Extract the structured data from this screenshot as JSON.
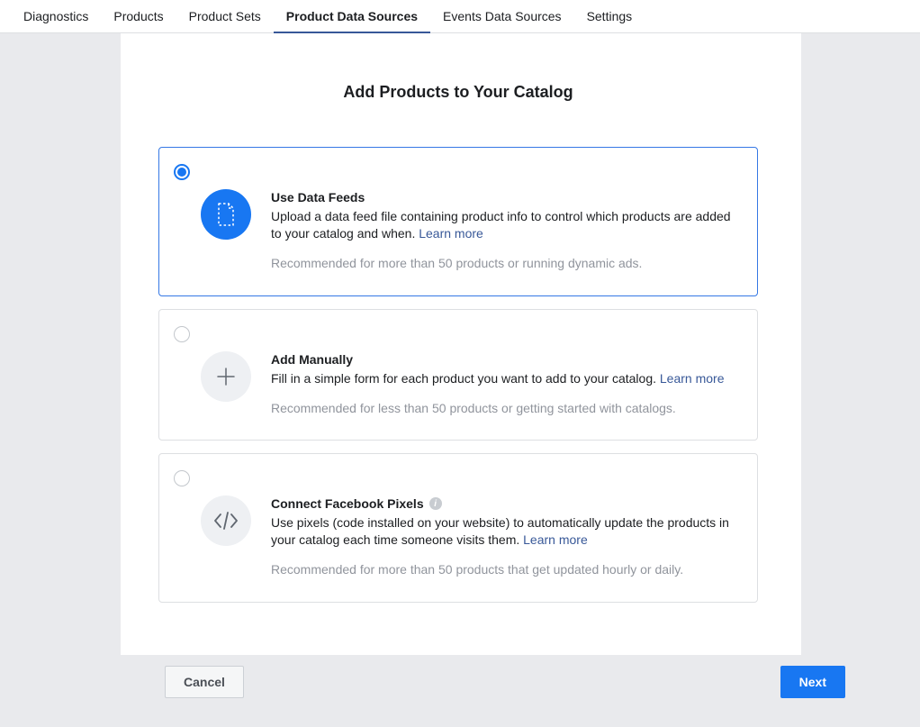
{
  "tabs": [
    "Diagnostics",
    "Products",
    "Product Sets",
    "Product Data Sources",
    "Events Data Sources",
    "Settings"
  ],
  "active_tab_index": 3,
  "heading": "Add Products to Your Catalog",
  "learn_more_label": "Learn more",
  "options": [
    {
      "title": "Use Data Feeds",
      "desc": "Upload a data feed file containing product info to control which products are added to your catalog and when. ",
      "note": "Recommended for more than 50 products or running dynamic ads.",
      "selected": true,
      "icon": "file-icon",
      "info": false
    },
    {
      "title": "Add Manually",
      "desc": "Fill in a simple form for each product you want to add to your catalog. ",
      "note": "Recommended for less than 50 products or getting started with catalogs.",
      "selected": false,
      "icon": "plus-icon",
      "info": false
    },
    {
      "title": "Connect Facebook Pixels",
      "desc": "Use pixels (code installed on your website) to automatically update the products in your catalog each time someone visits them. ",
      "note": "Recommended for more than 50 products that get updated hourly or daily.",
      "selected": false,
      "icon": "code-icon",
      "info": true
    }
  ],
  "footer": {
    "cancel_label": "Cancel",
    "next_label": "Next"
  }
}
